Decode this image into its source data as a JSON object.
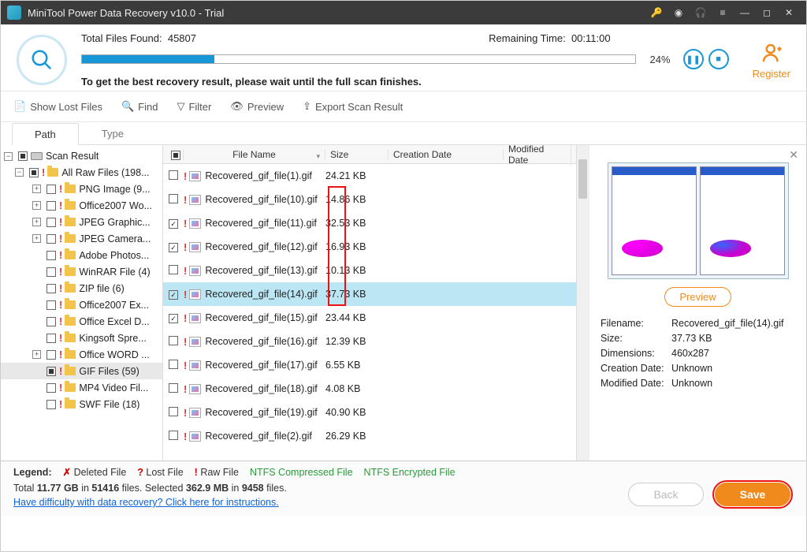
{
  "title": "MiniTool Power Data Recovery v10.0 - Trial",
  "scan": {
    "totalFilesLabel": "Total Files Found:",
    "totalFiles": "45807",
    "remainLabel": "Remaining Time:",
    "remain": "00:11:00",
    "percent": "24%",
    "hint": "To get the best recovery result, please wait until the full scan finishes."
  },
  "register": "Register",
  "toolbar": {
    "showLost": "Show Lost Files",
    "find": "Find",
    "filter": "Filter",
    "preview": "Preview",
    "export": "Export Scan Result"
  },
  "tabs": {
    "path": "Path",
    "type": "Type"
  },
  "tree": {
    "root": "Scan Result",
    "items": [
      "All Raw Files (198...",
      "PNG Image (9...",
      "Office2007 Wo...",
      "JPEG Graphic...",
      "JPEG Camera...",
      "Adobe Photos...",
      "WinRAR File (4)",
      "ZIP file (6)",
      "Office2007 Ex...",
      "Office Excel D...",
      "Kingsoft Spre...",
      "Office WORD ...",
      "GIF Files (59)",
      "MP4 Video Fil...",
      "SWF File (18)"
    ]
  },
  "cols": {
    "name": "File Name",
    "size": "Size",
    "cdate": "Creation Date",
    "mdate": "Modified Date"
  },
  "files": [
    {
      "n": "Recovered_gif_file(1).gif",
      "s": "24.21 KB",
      "c": false
    },
    {
      "n": "Recovered_gif_file(10).gif",
      "s": "14.86 KB",
      "c": false
    },
    {
      "n": "Recovered_gif_file(11).gif",
      "s": "32.53 KB",
      "c": true
    },
    {
      "n": "Recovered_gif_file(12).gif",
      "s": "16.93 KB",
      "c": true
    },
    {
      "n": "Recovered_gif_file(13).gif",
      "s": "10.13 KB",
      "c": false
    },
    {
      "n": "Recovered_gif_file(14).gif",
      "s": "37.73 KB",
      "c": true,
      "hl": true
    },
    {
      "n": "Recovered_gif_file(15).gif",
      "s": "23.44 KB",
      "c": true
    },
    {
      "n": "Recovered_gif_file(16).gif",
      "s": "12.39 KB",
      "c": false
    },
    {
      "n": "Recovered_gif_file(17).gif",
      "s": "6.55 KB",
      "c": false
    },
    {
      "n": "Recovered_gif_file(18).gif",
      "s": "4.08 KB",
      "c": false
    },
    {
      "n": "Recovered_gif_file(19).gif",
      "s": "40.90 KB",
      "c": false
    },
    {
      "n": "Recovered_gif_file(2).gif",
      "s": "26.29 KB",
      "c": false
    }
  ],
  "preview": {
    "button": "Preview",
    "labels": {
      "fn": "Filename:",
      "sz": "Size:",
      "dim": "Dimensions:",
      "cd": "Creation Date:",
      "md": "Modified Date:"
    },
    "vals": {
      "fn": "Recovered_gif_file(14).gif",
      "sz": "37.73 KB",
      "dim": "460x287",
      "cd": "Unknown",
      "md": "Unknown"
    }
  },
  "legend": {
    "label": "Legend:",
    "del": "Deleted File",
    "lost": "Lost File",
    "raw": "Raw File",
    "ntfsc": "NTFS Compressed File",
    "ntfse": "NTFS Encrypted File"
  },
  "totals": {
    "t1a": "Total ",
    "t1b": "11.77 GB",
    "t1c": " in ",
    "t1d": "51416",
    "t1e": " files.  Selected ",
    "t1f": "362.9 MB",
    "t1g": " in ",
    "t1h": "9458",
    "t1i": " files."
  },
  "help": "Have difficulty with data recovery? Click here for instructions.",
  "buttons": {
    "back": "Back",
    "save": "Save"
  }
}
